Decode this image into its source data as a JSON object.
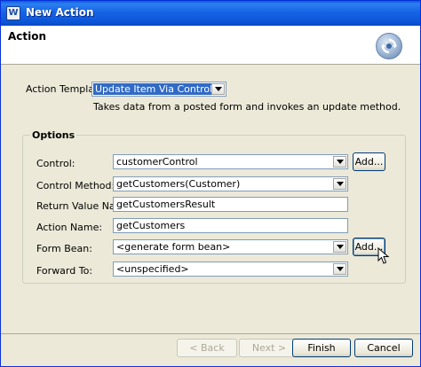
{
  "window": {
    "title": "New Action"
  },
  "header": {
    "heading": "Action",
    "icon": "wizard-refresh-icon"
  },
  "template": {
    "label": "Action Template:",
    "value": "Update Item Via Control",
    "description": "Takes data from a posted form and invokes an update method."
  },
  "options": {
    "legend": "Options",
    "control": {
      "label": "Control:",
      "value": "customerControl",
      "add_label": "Add..."
    },
    "control_method": {
      "label": "Control Method:",
      "value": "getCustomers(Customer)"
    },
    "return_value": {
      "label": "Return Value Name:",
      "value": "getCustomersResult"
    },
    "action_name": {
      "label": "Action Name:",
      "value": "getCustomers"
    },
    "form_bean": {
      "label": "Form Bean:",
      "value": "<generate form bean>",
      "add_label": "Add..."
    },
    "forward_to": {
      "label": "Forward To:",
      "value": "<unspecified>"
    }
  },
  "footer": {
    "back_label": "< Back",
    "next_label": "Next >",
    "finish_label": "Finish",
    "cancel_label": "Cancel"
  },
  "colors": {
    "titlebar": "#0a5bd5",
    "selection": "#316ac5",
    "dialog_bg": "#ece9d8"
  }
}
